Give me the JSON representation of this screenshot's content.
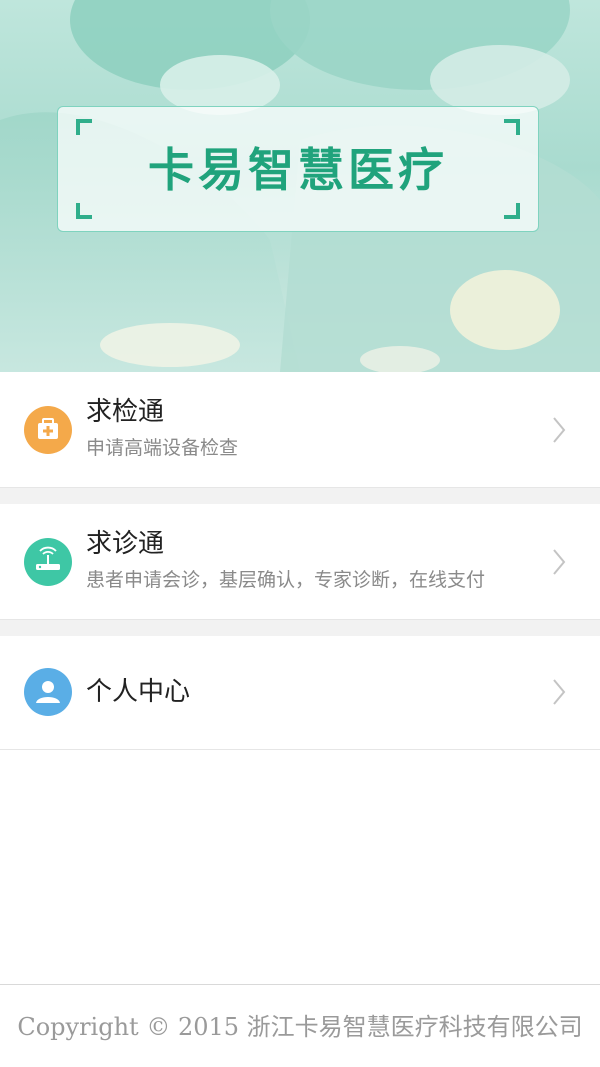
{
  "banner": {
    "logo_text": "卡易智慧医疗"
  },
  "menu": [
    {
      "title": "求检通",
      "subtitle": "申请高端设备检查",
      "icon": "medical-kit-icon",
      "icon_color": "#f4a94a"
    },
    {
      "title": "求诊通",
      "subtitle": "患者申请会诊，基层确认，专家诊断，在线支付",
      "icon": "wireless-router-icon",
      "icon_color": "#3ec7a5"
    },
    {
      "title": "个人中心",
      "subtitle": "",
      "icon": "user-icon",
      "icon_color": "#5aaee6"
    }
  ],
  "footer": {
    "copyright": "Copyright © 2015 浙江卡易智慧医疗科技有限公司"
  },
  "colors": {
    "brand_green": "#20a37c",
    "separator": "#f2f2f2"
  }
}
